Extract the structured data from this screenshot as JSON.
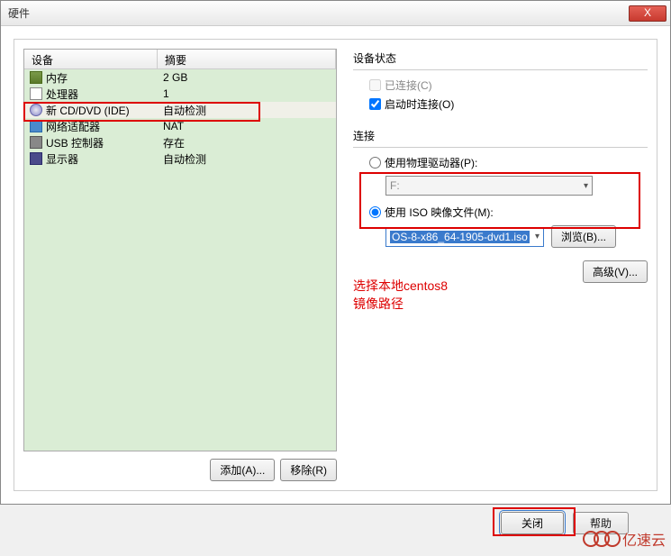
{
  "title": "硬件",
  "close_x": "X",
  "table": {
    "header_device": "设备",
    "header_summary": "摘要",
    "rows": [
      {
        "name": "内存",
        "summary": "2 GB",
        "icon": "memory"
      },
      {
        "name": "处理器",
        "summary": "1",
        "icon": "cpu"
      },
      {
        "name": "新 CD/DVD (IDE)",
        "summary": "自动检测",
        "icon": "dvd",
        "selected": true
      },
      {
        "name": "网络适配器",
        "summary": "NAT",
        "icon": "network"
      },
      {
        "name": "USB 控制器",
        "summary": "存在",
        "icon": "usb"
      },
      {
        "name": "显示器",
        "summary": "自动检测",
        "icon": "display"
      }
    ]
  },
  "buttons": {
    "add": "添加(A)...",
    "remove": "移除(R)",
    "browse": "浏览(B)...",
    "advanced": "高级(V)...",
    "close": "关闭",
    "help": "帮助"
  },
  "status": {
    "group_label": "设备状态",
    "connected": "已连接(C)",
    "connect_on_start": "启动时连接(O)"
  },
  "connection": {
    "group_label": "连接",
    "physical": "使用物理驱动器(P):",
    "physical_drive": "F:",
    "iso": "使用 ISO 映像文件(M):",
    "iso_path": "OS-8-x86_64-1905-dvd1.iso"
  },
  "annotation": {
    "line1": "选择本地centos8",
    "line2": "镜像路径"
  },
  "watermark": "亿速云"
}
